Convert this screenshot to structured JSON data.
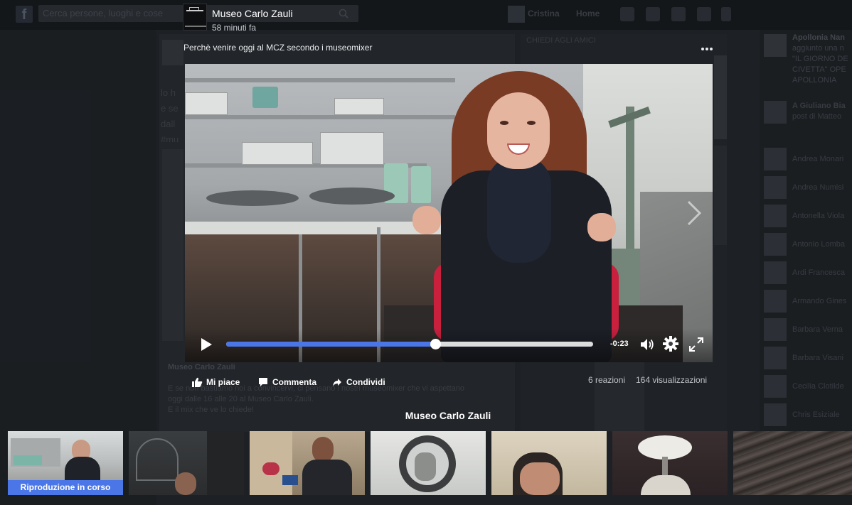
{
  "background": {
    "search_placeholder": "Cerca persone, luoghi e cose",
    "nav_user": "Cristina",
    "nav_home": "Home",
    "column_title": "CHIEDI AGLI AMICI",
    "post_text_fragment": "lo h\ne se\ndall\n#mu",
    "comment_author": "Museo Carlo Zauli",
    "comment_lines": [
      "E se non bastiamo noi a convincervi, ci pensano i nostri museomixer che vi aspettano",
      "oggi dalle 16 alle 20 al Museo Carlo Zauli.",
      "E il mix che ve lo chiede!"
    ],
    "sidebar_top": {
      "name": "Apollonia Nan",
      "lines": [
        "aggiunto una n",
        "\"IL GIORNO DE",
        "CIVETTA\" OPE",
        "APOLLONIA"
      ]
    },
    "sidebar_second": {
      "name": "A Giuliano Bia",
      "line": "post di Matteo"
    },
    "sidebar_contacts": [
      "Andrea Monari",
      "Andrea Numisi",
      "Antonella Viola",
      "Antonio Lomba",
      "Ardi Francesca",
      "Armando Gines",
      "Barbara Verna",
      "Barbara Visani",
      "Cecilia Clotilde",
      "Chris Esiziale"
    ]
  },
  "video": {
    "page_name": "Museo Carlo Zauli",
    "time_ago": "58 minuti fa",
    "description": "Perchè venire oggi al MCZ secondo i museomixer",
    "progress": 0.57,
    "time_remaining": "-0:23"
  },
  "actions": {
    "like": "Mi piace",
    "comment": "Commenta",
    "share": "Condividi",
    "reactions": "6 reazioni",
    "views": "164 visualizzazioni"
  },
  "playlist": {
    "title": "Museo Carlo Zauli",
    "now_playing": "Riproduzione in corso",
    "thumbnails": [
      {
        "name": "thumb-1",
        "active": true
      },
      {
        "name": "thumb-2",
        "active": false
      },
      {
        "name": "thumb-3",
        "active": false
      },
      {
        "name": "thumb-4",
        "active": false
      },
      {
        "name": "thumb-5",
        "active": false
      },
      {
        "name": "thumb-6",
        "active": false
      },
      {
        "name": "thumb-7",
        "active": false
      }
    ]
  },
  "colors": {
    "accent": "#4a76e8",
    "background": "#1b1d21"
  },
  "icons": [
    "facebook-logo-icon",
    "search-icon",
    "play-icon",
    "volume-icon",
    "gear-icon",
    "fullscreen-icon",
    "like-icon",
    "comment-icon",
    "share-icon",
    "more-icon",
    "next-arrow-icon"
  ]
}
